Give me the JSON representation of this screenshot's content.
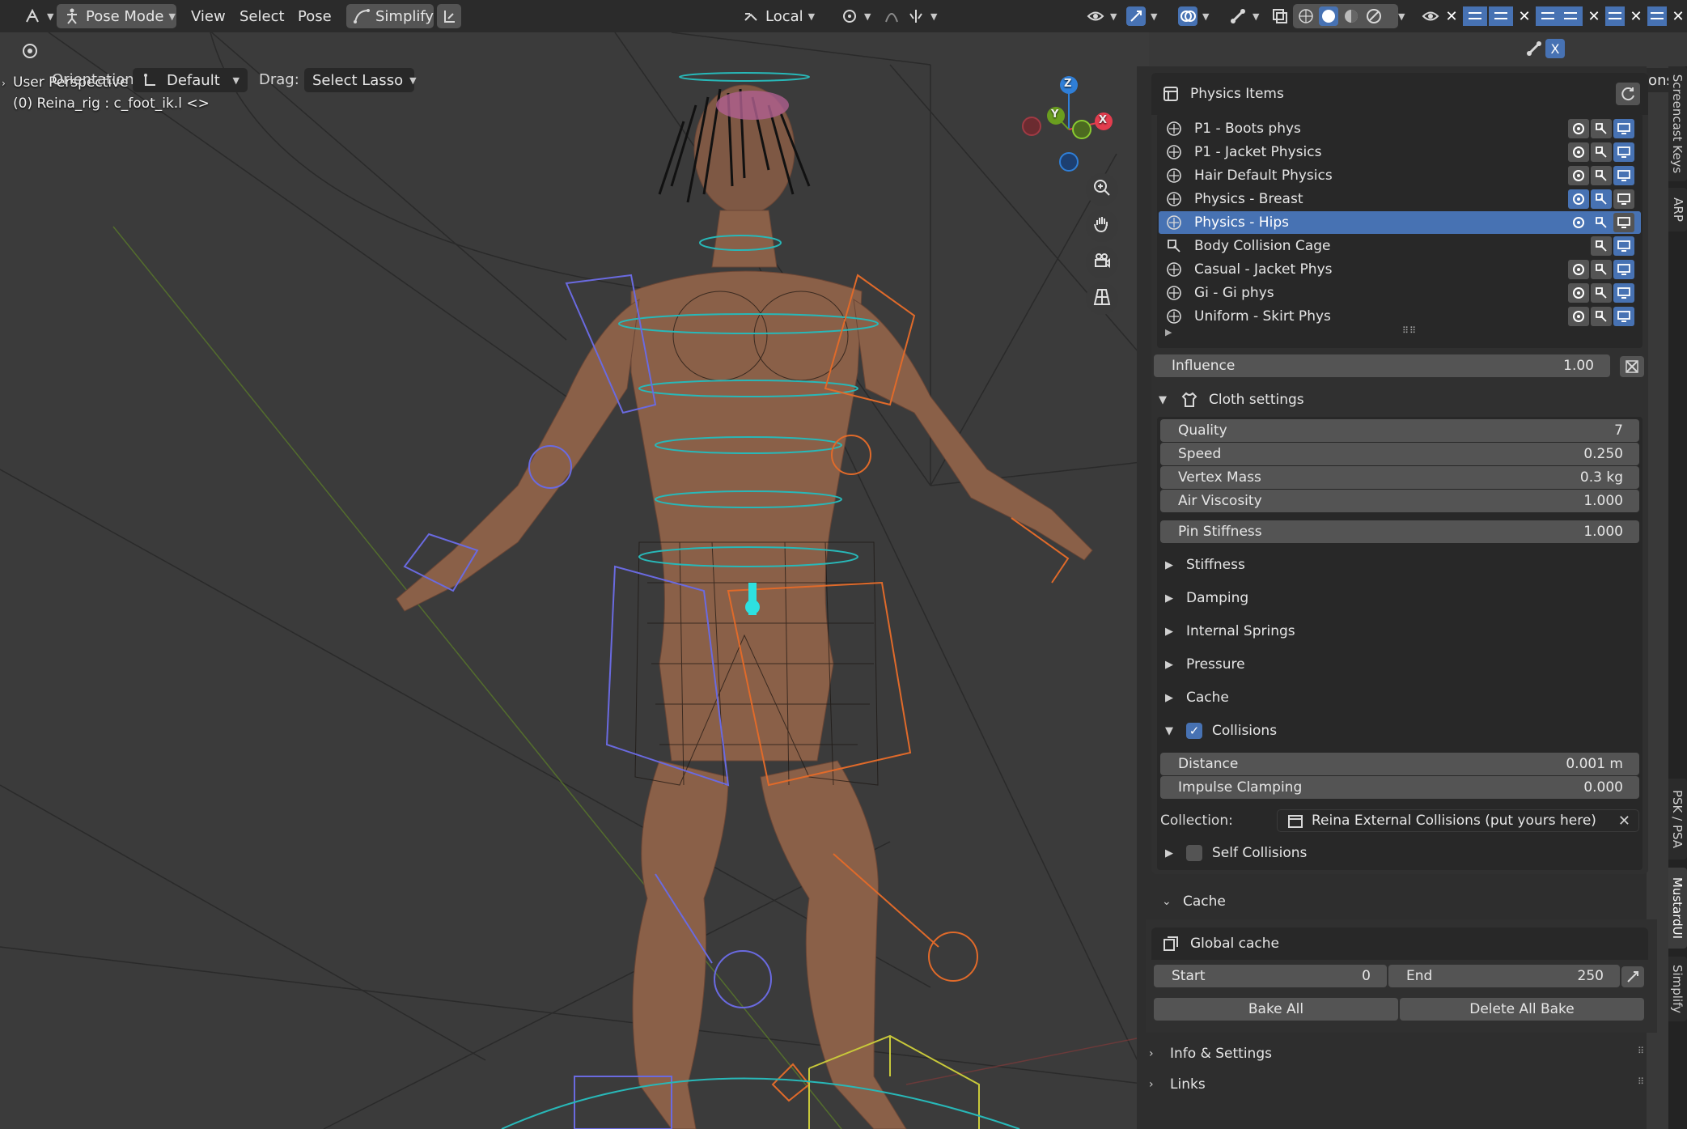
{
  "header": {
    "mode_label": "Pose Mode",
    "menus": [
      "View",
      "Select",
      "Pose"
    ],
    "simplify_label": "Simplify",
    "transform_space": "Local",
    "pose_options_label": "Pose Options"
  },
  "toolbar": {
    "orientation_label": "Orientation:",
    "orientation_value": "Default",
    "drag_label": "Drag:",
    "drag_value": "Select Lasso"
  },
  "viewport": {
    "perspective_label": "User Perspective",
    "active_object": "(0) Reina_rig : c_foot_ik.l <>",
    "gizmo": {
      "z": "Z",
      "y": "Y",
      "x": "X"
    }
  },
  "physics_panel": {
    "title": "Physics Items",
    "items": [
      {
        "label": "P1 - Boots phys",
        "selected": false,
        "toggles": [
          "off",
          "off",
          "on"
        ]
      },
      {
        "label": "P1 - Jacket Physics",
        "selected": false,
        "toggles": [
          "off",
          "off",
          "on"
        ]
      },
      {
        "label": "Hair Default Physics",
        "selected": false,
        "toggles": [
          "off",
          "off",
          "on"
        ]
      },
      {
        "label": "Physics - Breast",
        "selected": false,
        "toggles": [
          "on",
          "on",
          "off"
        ]
      },
      {
        "label": "Physics - Hips",
        "selected": true,
        "toggles": [
          "on",
          "on",
          "off"
        ]
      },
      {
        "label": "Body Collision Cage",
        "selected": false,
        "toggles": [
          "none",
          "off",
          "on"
        ]
      },
      {
        "label": "Casual - Jacket Phys",
        "selected": false,
        "toggles": [
          "off",
          "off",
          "on"
        ]
      },
      {
        "label": "Gi - Gi phys",
        "selected": false,
        "toggles": [
          "off",
          "off",
          "on"
        ]
      },
      {
        "label": "Uniform - Skirt Phys",
        "selected": false,
        "toggles": [
          "off",
          "off",
          "on"
        ]
      }
    ],
    "influence": {
      "label": "Influence",
      "value": "1.00"
    },
    "cloth_settings": {
      "title": "Cloth settings",
      "fields": [
        {
          "label": "Quality",
          "value": "7"
        },
        {
          "label": "Speed",
          "value": "0.250"
        },
        {
          "label": "Vertex Mass",
          "value": "0.3 kg"
        },
        {
          "label": "Air Viscosity",
          "value": "1.000"
        }
      ],
      "pin_stiffness": {
        "label": "Pin Stiffness",
        "value": "1.000"
      },
      "collapsed_sections": [
        "Stiffness",
        "Damping",
        "Internal Springs",
        "Pressure",
        "Cache"
      ],
      "collisions": {
        "label": "Collisions",
        "checked": true,
        "distance": {
          "label": "Distance",
          "value": "0.001 m"
        },
        "impulse_clamping": {
          "label": "Impulse Clamping",
          "value": "0.000"
        },
        "collection_label": "Collection:",
        "collection_value": "Reina External Collisions (put yours here)"
      },
      "self_collisions": {
        "label": "Self Collisions",
        "checked": false
      }
    }
  },
  "cache_panel": {
    "title": "Cache",
    "global_cache_label": "Global cache",
    "start": {
      "label": "Start",
      "value": "0"
    },
    "end": {
      "label": "End",
      "value": "250"
    },
    "bake_all": "Bake All",
    "delete_all_bake": "Delete All Bake"
  },
  "footer_panels": [
    "Info & Settings",
    "Links"
  ],
  "side_tabs": [
    "Screencast Keys",
    "ARP",
    "PSK / PSA",
    "MustardUI",
    "Simplify"
  ],
  "colors": {
    "accent": "#4772b3",
    "axis_x": "#e33d4e",
    "axis_y": "#6a9e1f",
    "axis_z": "#2f7fd8"
  }
}
